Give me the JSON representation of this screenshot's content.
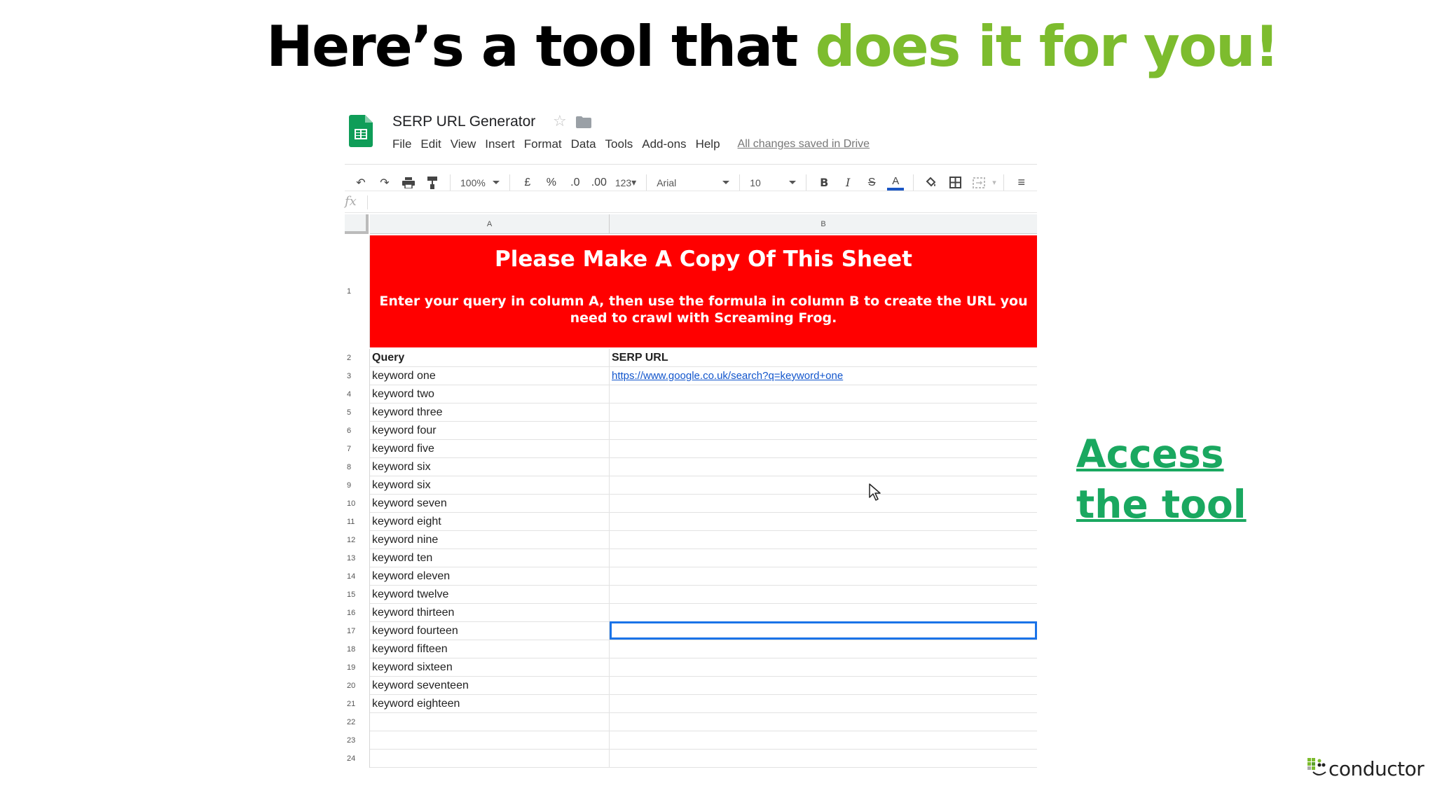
{
  "slide": {
    "title_prefix": "Here’s a tool that ",
    "title_highlight": "does it for you!",
    "access_line1": "Access",
    "access_line2": "the tool",
    "brand": "conductor",
    "colors": {
      "highlight": "#7dbc2e",
      "access_link": "#1aa860",
      "banner": "#ff0000"
    }
  },
  "sheet": {
    "doc_title": "SERP URL Generator",
    "menu": [
      "File",
      "Edit",
      "View",
      "Insert",
      "Format",
      "Data",
      "Tools",
      "Add-ons",
      "Help"
    ],
    "saved_status": "All changes saved in Drive",
    "toolbar": {
      "zoom": "100%",
      "currency": "£",
      "percent": "%",
      "decrease_decimal": ".0",
      "increase_decimal": ".00",
      "more_formats": "123",
      "font": "Arial",
      "font_size": "10"
    },
    "fx": "fx",
    "columns": [
      "A",
      "B"
    ],
    "banner_title": "Please Make A Copy Of This Sheet",
    "banner_subtitle": "Enter your query in column A, then use the formula in column B to create the URL you need to crawl with Screaming Frog.",
    "headers": {
      "query": "Query",
      "serp_url": "SERP URL"
    },
    "row_numbers": [
      "1",
      "2",
      "3",
      "4",
      "5",
      "6",
      "7",
      "8",
      "9",
      "10",
      "11",
      "12",
      "13",
      "14",
      "15",
      "16",
      "17",
      "18",
      "19",
      "20",
      "21",
      "22",
      "23",
      "24"
    ],
    "rows": [
      {
        "query": "keyword one",
        "url": "https://www.google.co.uk/search?q=keyword+one"
      },
      {
        "query": "keyword two",
        "url": ""
      },
      {
        "query": "keyword three",
        "url": ""
      },
      {
        "query": "keyword four",
        "url": ""
      },
      {
        "query": "keyword five",
        "url": ""
      },
      {
        "query": "keyword six",
        "url": ""
      },
      {
        "query": "keyword six",
        "url": ""
      },
      {
        "query": "keyword seven",
        "url": ""
      },
      {
        "query": "keyword eight",
        "url": ""
      },
      {
        "query": "keyword nine",
        "url": ""
      },
      {
        "query": "keyword ten",
        "url": ""
      },
      {
        "query": "keyword eleven",
        "url": ""
      },
      {
        "query": "keyword twelve",
        "url": ""
      },
      {
        "query": "keyword thirteen",
        "url": ""
      },
      {
        "query": "keyword fourteen",
        "url": ""
      },
      {
        "query": "keyword fifteen",
        "url": ""
      },
      {
        "query": "keyword sixteen",
        "url": ""
      },
      {
        "query": "keyword seventeen",
        "url": ""
      },
      {
        "query": "keyword eighteen",
        "url": ""
      },
      {
        "query": "",
        "url": ""
      },
      {
        "query": "",
        "url": ""
      },
      {
        "query": "",
        "url": ""
      }
    ],
    "selected_row": "17"
  }
}
